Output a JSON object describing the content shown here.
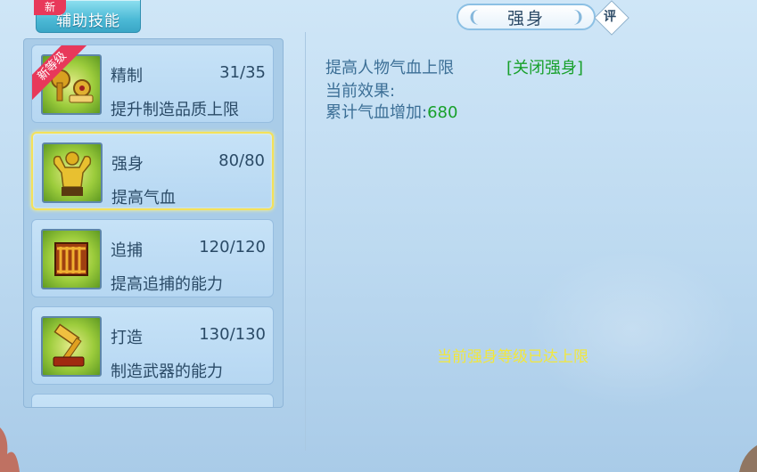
{
  "tab": {
    "label": "辅助技能",
    "new_badge": "新"
  },
  "skills": [
    {
      "name": "精制",
      "level": "31/35",
      "desc": "提升制造品质上限",
      "ribbon": "新等级",
      "icon": "refine-tools-icon"
    },
    {
      "name": "强身",
      "level": "80/80",
      "desc": "提高气血",
      "icon": "muscle-man-icon",
      "selected": true
    },
    {
      "name": "追捕",
      "level": "120/120",
      "desc": "提高追捕的能力",
      "icon": "cage-icon"
    },
    {
      "name": "打造",
      "level": "130/130",
      "desc": "制造武器的能力",
      "icon": "hammer-anvil-icon"
    }
  ],
  "detail": {
    "title": "强身",
    "rate_label": "评",
    "line1": "提高人物气血上限",
    "close_link": "[关闭强身]",
    "line2": "当前效果:",
    "line3_label": "累计气血增加:",
    "line3_value": "680",
    "max_message": "当前强身等级已达上限"
  },
  "colors": {
    "accent_green": "#17a02a",
    "highlight_yellow": "#f2e73c",
    "ribbon_red": "#e8385a"
  }
}
